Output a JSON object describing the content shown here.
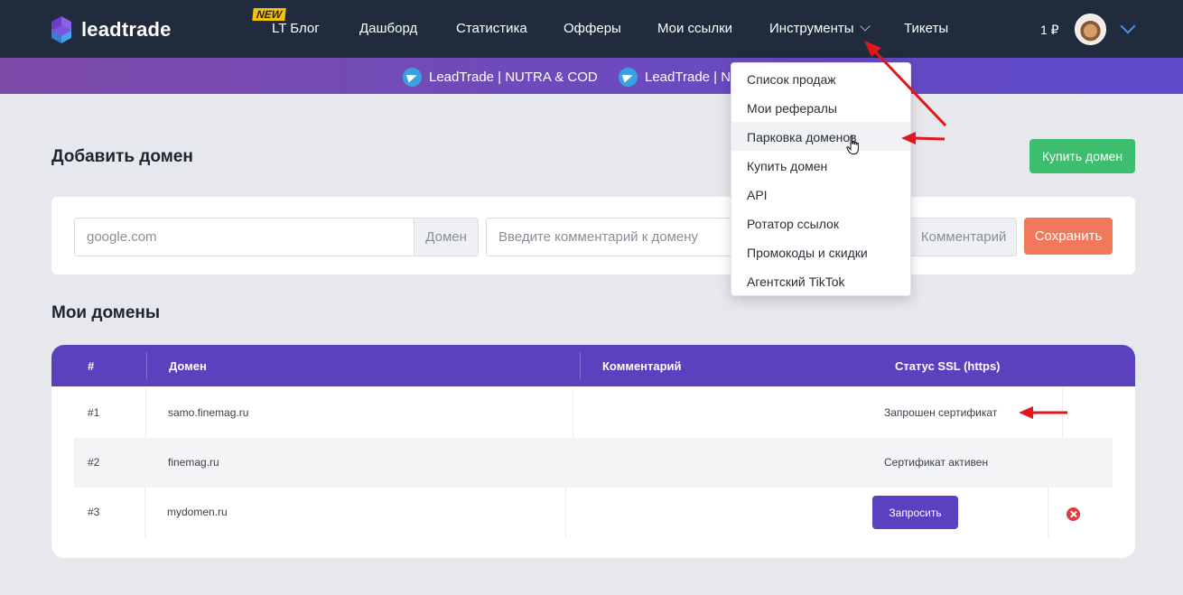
{
  "brand": {
    "name": "leadtrade"
  },
  "nav": {
    "new_badge": "NEW",
    "items": [
      "LT Блог",
      "Дашборд",
      "Статистика",
      "Офферы",
      "Мои ссылки",
      "Инструменты",
      "Тикеты"
    ],
    "balance": "1 ₽"
  },
  "banner": {
    "links": [
      "LeadTrade | NUTRA & COD",
      "LeadTrade | NE"
    ]
  },
  "add_domain": {
    "title": "Добавить домен",
    "buy_button": "Купить домен",
    "domain_placeholder": "google.com",
    "domain_addon": "Домен",
    "comment_placeholder": "Введите комментарий к домену",
    "comment_addon": "Комментарий",
    "save_button": "Сохранить"
  },
  "my_domains": {
    "title": "Мои домены",
    "columns": [
      "#",
      "Домен",
      "Комментарий",
      "Статус SSL (https)"
    ],
    "rows": [
      {
        "num": "#1",
        "domain": "samo.finemag.ru",
        "comment": "",
        "status": "Запрошен сертификат"
      },
      {
        "num": "#2",
        "domain": "finemag.ru",
        "comment": "",
        "status": "Сертификат активен"
      },
      {
        "num": "#3",
        "domain": "mydomen.ru",
        "comment": "",
        "action": "Запросить"
      }
    ]
  },
  "tools_menu": {
    "items": [
      "Список продаж",
      "Мои рефералы",
      "Парковка доменов",
      "Купить домен",
      "API",
      "Ротатор ссылок",
      "Промокоды и скидки",
      "Агентский TikTok"
    ],
    "hovered": "Парковка доменов"
  },
  "colors": {
    "nav_bg": "#202b3d",
    "accent_purple": "#5b41be",
    "green": "#3dbd6e",
    "orange": "#f1785a",
    "annotation_red": "#e3161b"
  }
}
